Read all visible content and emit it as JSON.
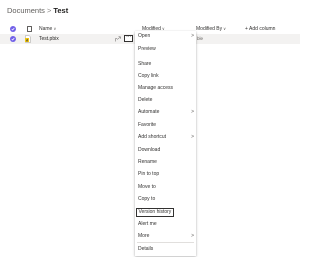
{
  "breadcrumb": {
    "root": "Documents",
    "separator": ">",
    "current": "Test"
  },
  "header": {
    "name": "Name",
    "modified": "Modified",
    "modified_by": "Modified By",
    "add_column": "+ Add column",
    "chevron": "∨"
  },
  "row": {
    "file_name": "Test.pbix",
    "modified_by": "ble",
    "more_glyph": "···"
  },
  "menu": {
    "items": [
      {
        "label": "Open",
        "submenu": true
      },
      {
        "label": "Preview"
      },
      {
        "label": "Share"
      },
      {
        "label": "Copy link"
      },
      {
        "label": "Manage access"
      },
      {
        "label": "Delete"
      },
      {
        "label": "Automate",
        "submenu": true
      },
      {
        "label": "Favorite"
      },
      {
        "label": "Add shortcut",
        "submenu": true
      },
      {
        "label": "Download"
      },
      {
        "label": "Rename"
      },
      {
        "label": "Pin to top"
      },
      {
        "label": "Move to"
      },
      {
        "label": "Copy to"
      },
      {
        "label": "Version history",
        "highlighted": true
      },
      {
        "label": "Alert me"
      },
      {
        "label": "More",
        "submenu": true
      },
      {
        "label": "Details"
      }
    ],
    "submenu_glyph": ">"
  },
  "colors": {
    "accent": "#7160e8",
    "row_selected": "#f3f2f1",
    "file_icon": "#f2c811"
  },
  "icons": [
    "check-circle-icon",
    "document-icon",
    "powerbi-file-icon",
    "share-icon",
    "more-icon",
    "chevron-down-icon",
    "chevron-right-icon"
  ]
}
